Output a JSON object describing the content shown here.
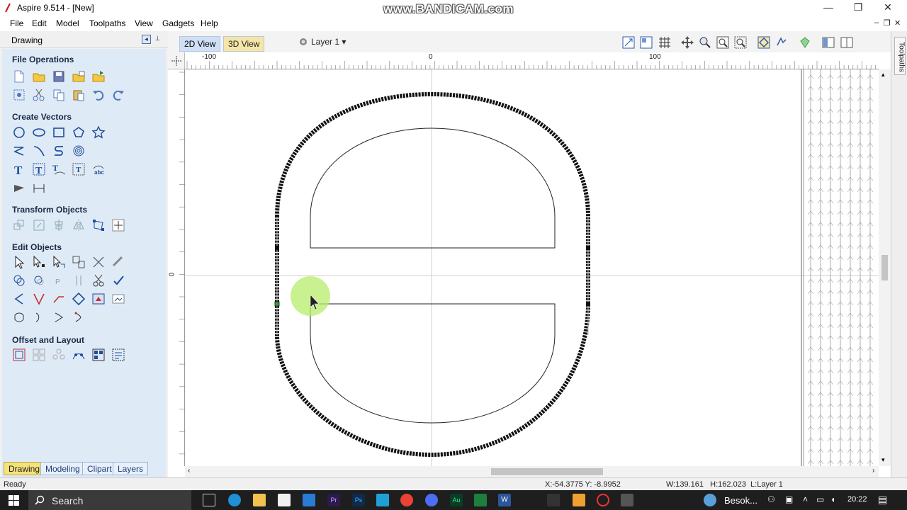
{
  "window": {
    "title": "Aspire 9.514 - [New]",
    "watermark": "www.BANDICAM.com",
    "minimize": "—",
    "restore": "❐",
    "close": "✕"
  },
  "menu": {
    "items": [
      "File",
      "Edit",
      "Model",
      "Toolpaths",
      "View",
      "Gadgets",
      "Help"
    ],
    "mdi_minimize": "–",
    "mdi_restore": "❐",
    "mdi_close": "✕"
  },
  "left_panel": {
    "title": "Drawing",
    "sections": {
      "file_operations": "File Operations",
      "create_vectors": "Create Vectors",
      "transform_objects": "Transform Objects",
      "edit_objects": "Edit Objects",
      "offset_layout": "Offset and Layout"
    },
    "tabs": [
      "Drawing",
      "Modeling",
      "Clipart",
      "Layers"
    ],
    "active_tab": "Drawing"
  },
  "view": {
    "tab_2d": "2D View",
    "tab_3d": "3D View",
    "active": "2D View",
    "layer_selector": "Layer 1 ▾"
  },
  "toolpaths_panel": {
    "label": "Toolpaths"
  },
  "rulers": {
    "h_labels": [
      "-100",
      "0",
      "100"
    ],
    "v_labels": [
      "0"
    ]
  },
  "status": {
    "ready": "Ready",
    "cursor": "X:-54.3775 Y: -8.9952",
    "selection": "W:139.161   H:162.023  L:Layer 1"
  },
  "taskbar": {
    "search_label": "Search",
    "tray_text": "Besok...",
    "clock": "20:22"
  },
  "colors": {
    "panel_bg": "#dfeaf7",
    "active_tab": "#f6e27a",
    "view_tab_active": "#cfe0f5",
    "taskbar": "#1e1e1e",
    "cursor_highlight": "#b7ec6a"
  }
}
